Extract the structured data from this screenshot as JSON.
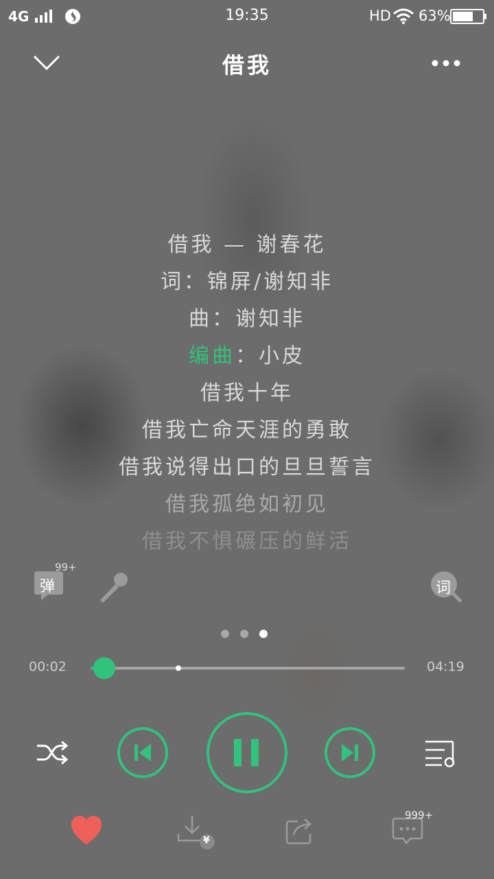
{
  "status_bar": {
    "network": "4G",
    "time": "19:35",
    "hd": "HD",
    "battery_percent": "63%"
  },
  "header": {
    "title": "借我",
    "collapse_icon": "chevron-down-icon",
    "more_icon": "more-dots-icon"
  },
  "lyrics": {
    "line_1": "借我 — 谢春花",
    "line_2": "词：锦屏/谢知非",
    "line_3": "曲：谢知非",
    "line_4_highlight": "编曲",
    "line_4_rest": "：小皮",
    "line_5": "借我十年",
    "line_6": "借我亡命天涯的勇敢",
    "line_7": "借我说得出口的旦旦誓言",
    "line_8": "借我孤绝如初见",
    "line_9": "借我不惧碾压的鲜活"
  },
  "tools": {
    "danmu_label": "弹",
    "danmu_badge": "99+",
    "lyric_search_label": "词"
  },
  "page_indicator": {
    "count": 3,
    "active_index": 2
  },
  "progress": {
    "elapsed": "00:02",
    "total": "04:19",
    "played_fraction": 0.04,
    "buffer_marker_fraction": 0.28
  },
  "controls": {
    "state": "playing"
  },
  "actions": {
    "comment_badge": "999+",
    "download_price_symbol": "¥"
  },
  "colors": {
    "accent": "#31c27c",
    "like": "#f0605a",
    "background": "#6f6f6f"
  }
}
